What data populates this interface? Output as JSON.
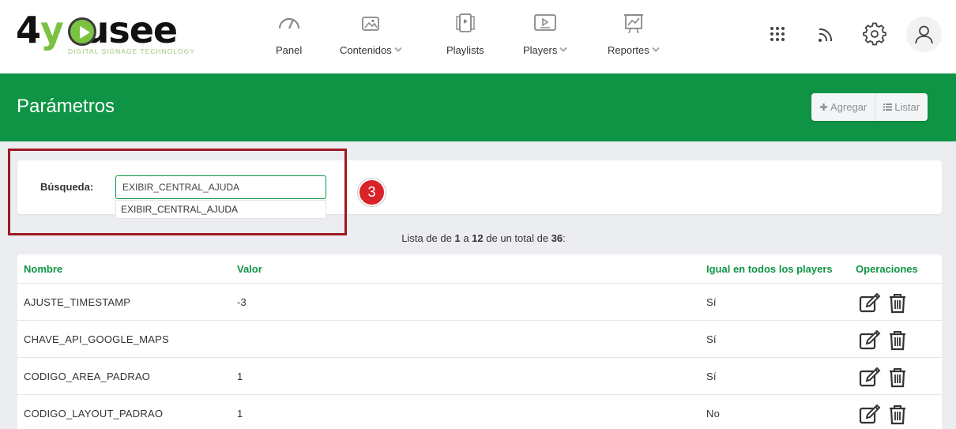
{
  "brand": {
    "logo_text": "4yousee",
    "tagline": "DIGITAL SIGNAGE TECHNOLOGY"
  },
  "nav": {
    "items": [
      {
        "label": "Panel",
        "icon": "gauge-icon",
        "has_dropdown": false
      },
      {
        "label": "Contenidos",
        "icon": "images-icon",
        "has_dropdown": true
      },
      {
        "label": "Playlists",
        "icon": "playlist-icon",
        "has_dropdown": false
      },
      {
        "label": "Players",
        "icon": "player-icon",
        "has_dropdown": true
      },
      {
        "label": "Reportes",
        "icon": "chart-icon",
        "has_dropdown": true
      }
    ],
    "right_icons": [
      "apps-grid-icon",
      "rss-icon",
      "gear-icon",
      "user-icon"
    ]
  },
  "page": {
    "title": "Parámetros",
    "actions": [
      {
        "label": "Agregar",
        "icon": "plus-icon"
      },
      {
        "label": "Listar",
        "icon": "list-icon"
      }
    ]
  },
  "search": {
    "label": "Búsqueda:",
    "value": "EXIBIR_CENTRAL_AJUDA",
    "suggestion": "EXIBIR_CENTRAL_AJUDA",
    "step_badge": "3"
  },
  "summary": {
    "prefix": "Lista de de",
    "from": "1",
    "to_word": "a",
    "to": "12",
    "total_text": "de un total de",
    "total": "36",
    "suffix": ":"
  },
  "table": {
    "headers": [
      "Nombre",
      "Valor",
      "Igual en todos los players",
      "Operaciones"
    ],
    "rows": [
      {
        "name": "AJUSTE_TIMESTAMP",
        "value": "-3",
        "same": "Sí"
      },
      {
        "name": "CHAVE_API_GOOGLE_MAPS",
        "value": "",
        "same": "Sí"
      },
      {
        "name": "CODIGO_AREA_PADRAO",
        "value": "1",
        "same": "Sí"
      },
      {
        "name": "CODIGO_LAYOUT_PADRAO",
        "value": "1",
        "same": "No"
      }
    ],
    "operation_icons": [
      "edit-icon",
      "trash-icon"
    ]
  },
  "colors": {
    "primary_green": "#0e9444",
    "accent_red": "#d8232a",
    "highlight_border": "#a01820"
  }
}
